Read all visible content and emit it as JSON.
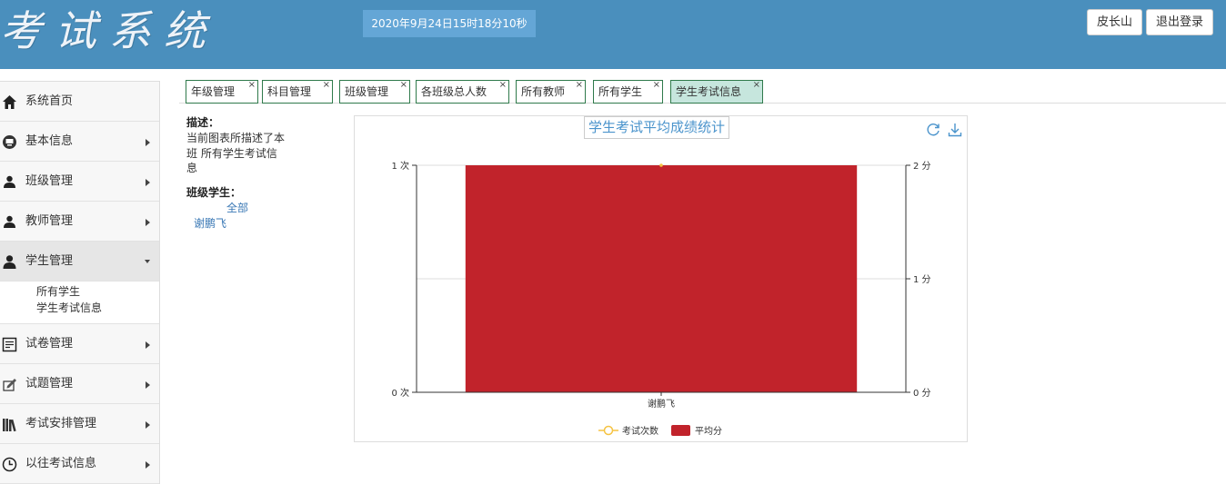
{
  "header": {
    "logo_text": "考试系统",
    "datetime": "2020年9月24日15时18分10秒",
    "user_button": "皮长山",
    "logout_button": "退出登录"
  },
  "sidebar": {
    "items": [
      {
        "label": "系统首页",
        "icon": "home-icon",
        "expandable": false
      },
      {
        "label": "基本信息",
        "icon": "monitor-icon",
        "expandable": true
      },
      {
        "label": "班级管理",
        "icon": "users-icon",
        "expandable": true
      },
      {
        "label": "教师管理",
        "icon": "users-icon",
        "expandable": true
      },
      {
        "label": "学生管理",
        "icon": "user-icon",
        "expandable": true,
        "expanded": true
      },
      {
        "label": "试卷管理",
        "icon": "document-icon",
        "expandable": true
      },
      {
        "label": "试题管理",
        "icon": "edit-icon",
        "expandable": true
      },
      {
        "label": "考试安排管理",
        "icon": "books-icon",
        "expandable": true
      },
      {
        "label": "以往考试信息",
        "icon": "clock-icon",
        "expandable": true
      }
    ],
    "student_subitems": [
      "所有学生",
      "学生考试信息"
    ]
  },
  "tabs": [
    {
      "label": "年级管理",
      "active": false
    },
    {
      "label": "科目管理",
      "active": false
    },
    {
      "label": "班级管理",
      "active": false
    },
    {
      "label": "各班级总人数",
      "active": false
    },
    {
      "label": "所有教师",
      "active": false
    },
    {
      "label": "所有学生",
      "active": false
    },
    {
      "label": "学生考试信息",
      "active": true
    }
  ],
  "tab_close_symbol": "×",
  "info": {
    "desc_title": "描述：",
    "desc_text": "当前图表所描述了本班 所有学生考试信息",
    "students_title": "班级学生：",
    "all_link": "全部",
    "student_name": "谢鹏飞"
  },
  "chart_data": {
    "type": "bar",
    "title": "学生考试平均成绩统计",
    "categories": [
      "谢鹏飞"
    ],
    "series": [
      {
        "name": "考试次数",
        "kind": "line",
        "axis": "left",
        "values": [
          1
        ],
        "color": "#f5c342"
      },
      {
        "name": "平均分",
        "kind": "bar",
        "axis": "right",
        "values": [
          2
        ],
        "color": "#c1232b"
      }
    ],
    "left_axis": {
      "ticks": [
        "0 次",
        "1 次"
      ],
      "min": 0,
      "max": 1
    },
    "right_axis": {
      "ticks": [
        "0 分",
        "1 分",
        "2 分"
      ],
      "min": 0,
      "max": 2
    },
    "legend_position": "bottom-center",
    "toolbox": [
      "refresh-icon",
      "download-icon"
    ]
  }
}
